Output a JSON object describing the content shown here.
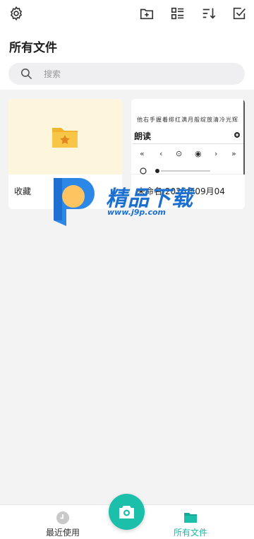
{
  "header": {
    "title": "所有文件",
    "icons": [
      "settings-icon",
      "new-folder-icon",
      "list-view-icon",
      "sort-icon",
      "select-icon"
    ]
  },
  "search": {
    "placeholder": "搜索"
  },
  "files": [
    {
      "name": "收藏",
      "type": "folder"
    },
    {
      "name": "未命名 2025年09月04",
      "type": "document",
      "preview_text": "他右手握着绯红满月般绽放清冷光辉",
      "preview_title": "朗读"
    }
  ],
  "watermark": {
    "text": "精品下载",
    "url": "www.j9p.com"
  },
  "bottom_nav": {
    "recent_label": "最近使用",
    "all_label": "所有文件",
    "active": "all"
  },
  "colors": {
    "accent": "#1cbfa9",
    "folder": "#f5c242",
    "folder_bg": "#fef6dc"
  }
}
